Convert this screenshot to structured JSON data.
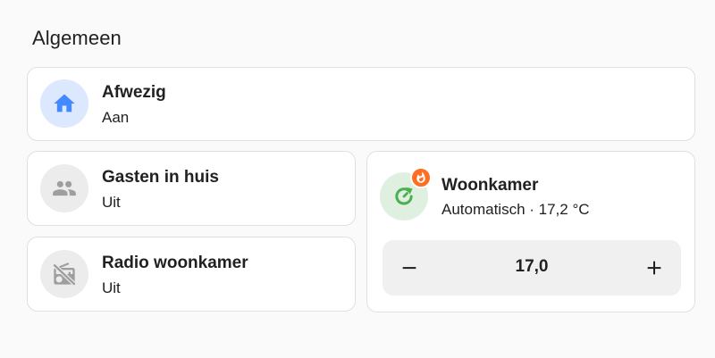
{
  "section": {
    "title": "Algemeen"
  },
  "tiles": {
    "afwezig": {
      "name": "Afwezig",
      "state": "Aan",
      "icon": "home-icon",
      "color": "#448aff"
    },
    "gasten": {
      "name": "Gasten in huis",
      "state": "Uit",
      "icon": "account-group-icon",
      "color": "#9e9e9e"
    },
    "radio": {
      "name": "Radio woonkamer",
      "state": "Uit",
      "icon": "radio-off-icon",
      "color": "#9e9e9e"
    },
    "woonkamer": {
      "name": "Woonkamer",
      "state": "Automatisch · 17,2 °C",
      "icon": "thermostat-auto-icon",
      "badge_icon": "fire-icon",
      "color": "#4caf50",
      "badge_color": "#ff6f22",
      "target_value": "17,0"
    }
  }
}
